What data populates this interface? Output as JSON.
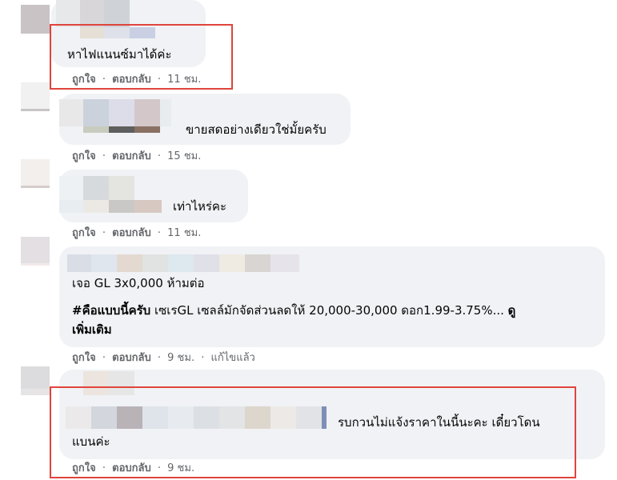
{
  "colors": {
    "bubble": "#f0f2f5",
    "meta_text": "#65676b",
    "highlight_box": "#e0443c"
  },
  "comments": [
    {
      "text": "หาไฟแนนซ์มาได้ค่ะ",
      "like": "ถูกใจ",
      "reply": "ตอบกลับ",
      "time": "11 ชม.",
      "sep": "·"
    },
    {
      "text": "ขายสดอย่างเดียวใช่มั้ยครับ",
      "like": "ถูกใจ",
      "reply": "ตอบกลับ",
      "time": "15 ชม.",
      "sep": "·"
    },
    {
      "text": "เท่าไหร่คะ",
      "like": "ถูกใจ",
      "reply": "ตอบกลับ",
      "time": "11 ชม.",
      "sep": "·"
    },
    {
      "line1": "เจอ GL 3x0,000 ห้ามต่อ",
      "hashtag": "#คือแบบนี้ครับ",
      "line2": " เซเรGL เซลล์มักจัดส่วนลดให้ 20,000-30,000 ดอก1.99-3.75%... ",
      "see_more_1": "ดู",
      "see_more_2": "เพิ่มเติม",
      "like": "ถูกใจ",
      "reply": "ตอบกลับ",
      "time": "9 ชม.",
      "edited": "แก้ไขแล้ว",
      "sep": "·"
    },
    {
      "text": "รบกวนไม่แจ้งราคาในนี้นะคะ เดี๋ยวโดน",
      "text2": "แบนค่ะ",
      "like": "ถูกใจ",
      "reply": "ตอบกลับ",
      "time": "9 ชม.",
      "sep": "·"
    }
  ]
}
